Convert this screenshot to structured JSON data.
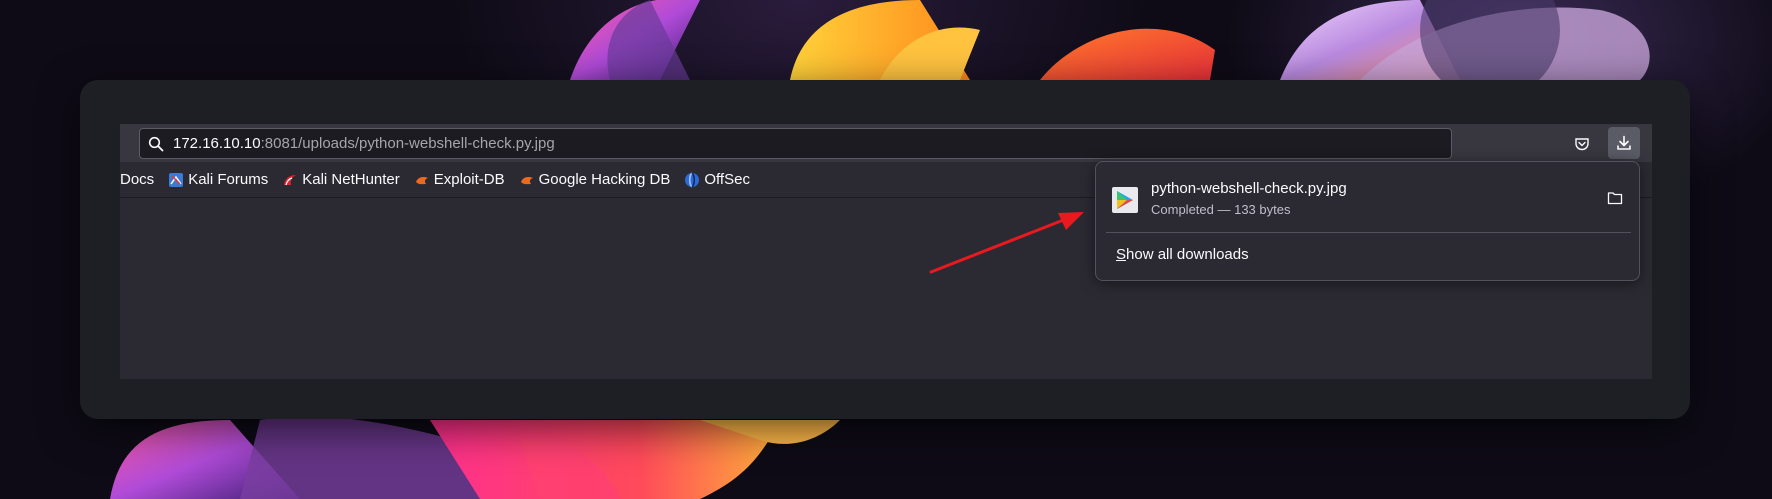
{
  "browser": {
    "url": {
      "host": "172.16.10.10",
      "path": ":8081/uploads/python-webshell-check.py.jpg"
    },
    "bookmarks": [
      {
        "label": "Docs",
        "icon": "none"
      },
      {
        "label": "Kali Forums",
        "icon": "kali-forums-icon"
      },
      {
        "label": "Kali NetHunter",
        "icon": "kali-nethunter-icon"
      },
      {
        "label": "Exploit-DB",
        "icon": "exploit-db-icon"
      },
      {
        "label": "Google Hacking DB",
        "icon": "exploit-db-icon"
      },
      {
        "label": "OffSec",
        "icon": "offsec-icon"
      }
    ]
  },
  "downloads": {
    "items": [
      {
        "filename": "python-webshell-check.py.jpg",
        "status": "Completed — 133 bytes"
      }
    ],
    "show_all_label_accesskey": "S",
    "show_all_label_rest": "how all downloads"
  },
  "colors": {
    "annotation_arrow": "#e8191f",
    "toolbar": "#38373f",
    "panel": "#2b2a33"
  }
}
